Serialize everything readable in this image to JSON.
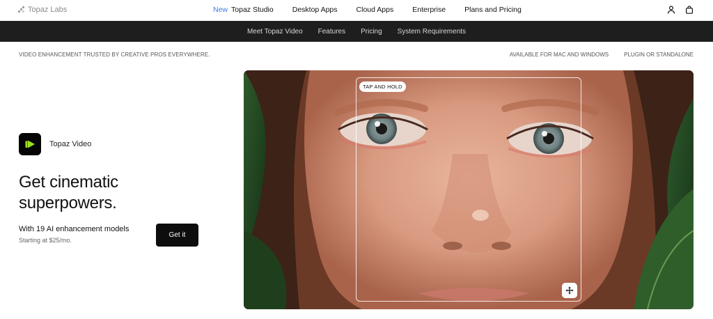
{
  "topnav": {
    "logo_text": "Topaz Labs",
    "new_tag": "New",
    "items": [
      "Topaz Studio",
      "Desktop Apps",
      "Cloud Apps",
      "Enterprise",
      "Plans and Pricing"
    ],
    "icons": [
      "user-icon",
      "shopping-bag-icon"
    ]
  },
  "subnav": {
    "items": [
      "Meet Topaz Video",
      "Features",
      "Pricing",
      "System Requirements"
    ]
  },
  "strip": {
    "left": "VIDEO ENHANCEMENT TRUSTED BY CREATIVE PROS EVERYWHERE.",
    "right": [
      "AVAILABLE FOR MAC AND WINDOWS",
      "PLUGIN OR STANDALONE"
    ]
  },
  "hero": {
    "app_name": "Topaz Video",
    "headline_line1": "Get cinematic",
    "headline_line2": "superpowers.",
    "sub_title": "With 19 AI enhancement models",
    "price_text": "Starting at $25/mo.",
    "cta_label": "Get it",
    "compare_label": "TAP AND HOLD",
    "colors": {
      "accent": "#9be01c",
      "cta_bg": "#0d0d0d",
      "subnav_bg": "#1e1e1e"
    }
  }
}
